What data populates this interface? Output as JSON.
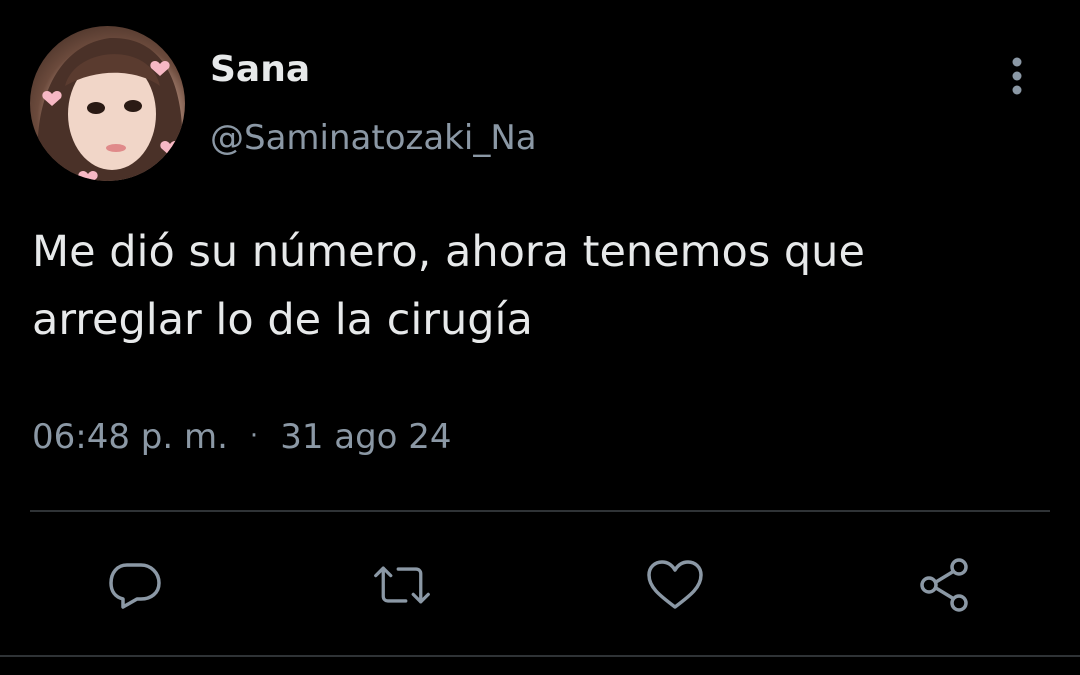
{
  "author": {
    "name": "Sana",
    "handle": "@Saminatozaki_Na"
  },
  "tweet": {
    "text": "Me dió su número, ahora tenemos que arreglar lo de la cirugía",
    "time": "06:48 p. m.",
    "separator": "·",
    "date": "31 ago 24"
  },
  "icons": {
    "more": "more-vertical-icon",
    "reply": "reply-icon",
    "retweet": "retweet-icon",
    "like": "heart-icon",
    "share": "share-icon"
  },
  "colors": {
    "background": "#000000",
    "primary_text": "#e7e9ea",
    "secondary_text": "#8b98a5",
    "divider": "#2f3336"
  }
}
